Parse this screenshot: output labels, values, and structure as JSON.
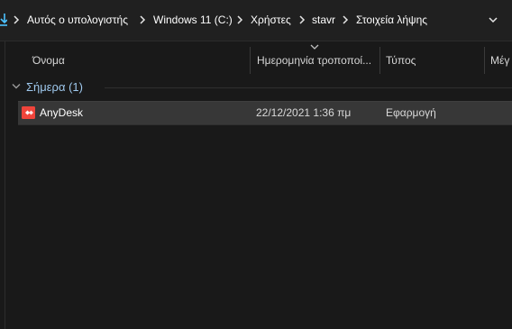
{
  "address_bar": {
    "breadcrumbs": [
      "Αυτός ο υπολογιστής",
      "Windows 11 (C:)",
      "Χρήστες",
      "stavr",
      "Στοιχεία λήψης"
    ],
    "icons": {
      "location": "download-icon",
      "separator": "chevron-right-icon",
      "history": "chevron-down-icon"
    }
  },
  "columns": {
    "name": "Όνομα",
    "date_modified": "Ημερομηνία τροποποί...",
    "type": "Τύπος",
    "size": "Μέγ"
  },
  "group": {
    "title": "Σήμερα (1)",
    "icon": "chevron-down-icon"
  },
  "files": [
    {
      "name": "AnyDesk",
      "date_modified": "22/12/2021 1:36 πμ",
      "type": "Εφαρμογή",
      "icon": "anydesk-app-icon",
      "icon_color": "#ef443b"
    }
  ],
  "colors": {
    "background": "#191919",
    "selected_row": "#373737",
    "group_title": "#9fc9ee",
    "accent": "#4cc2ff"
  }
}
